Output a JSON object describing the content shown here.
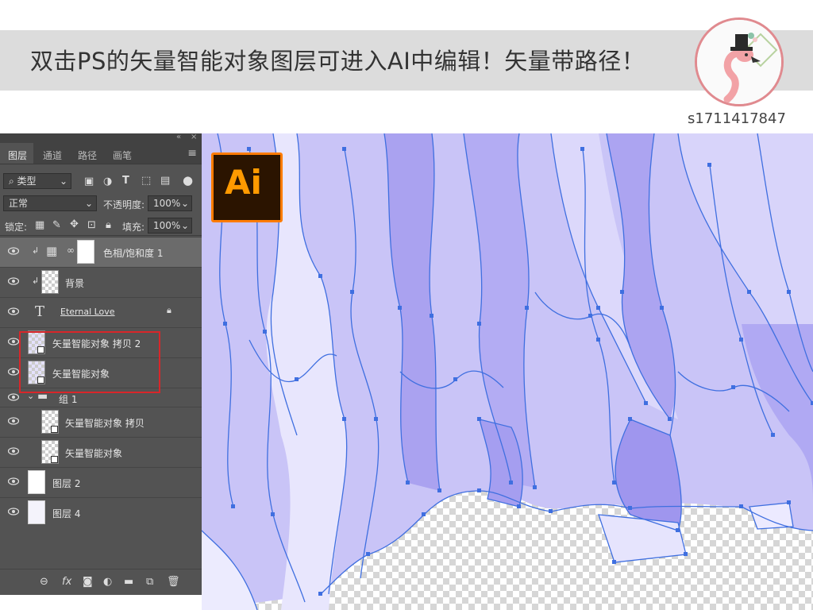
{
  "banner": {
    "title": "双击PS的矢量智能对象图层可进入AI中编辑！矢量带路径！",
    "user_id": "s1711417847"
  },
  "ai_logo": {
    "text": "Ai"
  },
  "panel": {
    "collapse_glyph": "«",
    "close_glyph": "×",
    "tabs": [
      {
        "label": "图层",
        "active": true
      },
      {
        "label": "通道",
        "active": false
      },
      {
        "label": "路径",
        "active": false
      },
      {
        "label": "画笔",
        "active": false
      }
    ],
    "menu_glyph": "≡",
    "filter": {
      "label": "类型"
    },
    "blend_mode": "正常",
    "opacity_label": "不透明度:",
    "opacity_value": "100%",
    "lock_label": "锁定:",
    "fill_label": "填充:",
    "fill_value": "100%",
    "layers": [
      {
        "name": "色相/饱和度 1",
        "type": "adjustment",
        "selected": true,
        "clipped": true
      },
      {
        "name": "背景",
        "type": "raster",
        "clipped": true
      },
      {
        "name": "Eternal Love",
        "type": "text",
        "locked": true
      },
      {
        "name": "矢量智能对象 拷贝 2",
        "type": "smart-object"
      },
      {
        "name": "矢量智能对象",
        "type": "smart-object"
      },
      {
        "name": "组 1",
        "type": "group",
        "expanded": true
      },
      {
        "name": "矢量智能对象 拷贝",
        "type": "smart-object",
        "indented": true
      },
      {
        "name": "矢量智能对象",
        "type": "smart-object",
        "indented": true
      },
      {
        "name": "图层 2",
        "type": "raster-white"
      },
      {
        "name": "图层 4",
        "type": "raster-white"
      }
    ],
    "footer_icons": [
      "link-icon",
      "fx-icon",
      "mask-icon",
      "adjustment-icon",
      "folder-icon",
      "new-layer-icon",
      "trash-icon"
    ]
  },
  "colors": {
    "panel_bg": "#535353",
    "canvas_purple": "#c9c4f7",
    "path_blue": "#3f6fe0",
    "highlight": "#d8262a",
    "ai_orange": "#ff9a00"
  }
}
